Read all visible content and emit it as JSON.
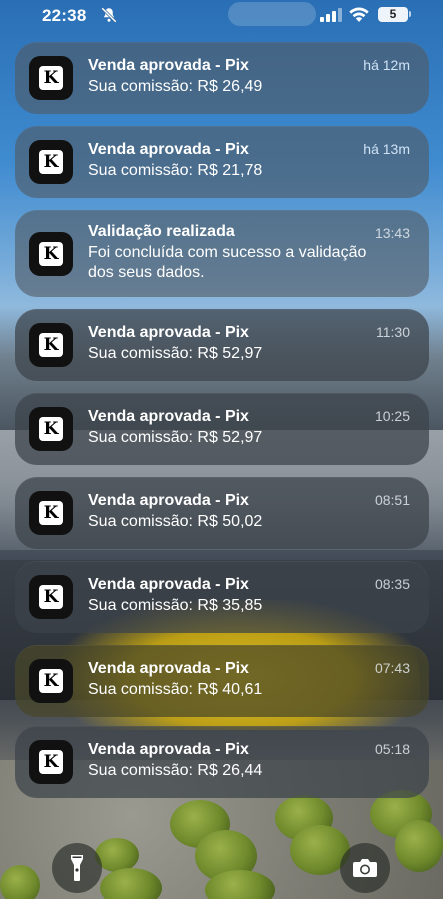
{
  "status": {
    "time": "22:38",
    "battery": "5"
  },
  "notifications": [
    {
      "title": "Venda aprovada - Pix",
      "body": "Sua comissão: R$ 26,49",
      "time": "há 12m"
    },
    {
      "title": "Venda aprovada - Pix",
      "body": "Sua comissão: R$ 21,78",
      "time": "há 13m"
    },
    {
      "title": "Validação realizada",
      "body": "Foi concluída com sucesso a validação",
      "body2": "dos seus dados.",
      "time": "13:43"
    },
    {
      "title": "Venda aprovada - Pix",
      "body": "Sua comissão: R$ 52,97",
      "time": "11:30"
    },
    {
      "title": "Venda aprovada - Pix",
      "body": "Sua comissão: R$ 52,97",
      "time": "10:25"
    },
    {
      "title": "Venda aprovada - Pix",
      "body": "Sua comissão: R$ 50,02",
      "time": "08:51"
    },
    {
      "title": "Venda aprovada - Pix",
      "body": "Sua comissão: R$ 35,85",
      "time": "08:35"
    },
    {
      "title": "Venda aprovada - Pix",
      "body": "Sua comissão: R$ 40,61",
      "time": "07:43"
    },
    {
      "title": "Venda aprovada - Pix",
      "body": "Sua comissão: R$ 26,44",
      "time": "05:18"
    }
  ],
  "app_icon_letter": "K",
  "icons": {
    "flashlight": "flashlight-icon",
    "camera": "camera-icon",
    "silent": "bell-slash-icon",
    "signal": "cellular-signal-icon",
    "wifi": "wifi-icon"
  }
}
